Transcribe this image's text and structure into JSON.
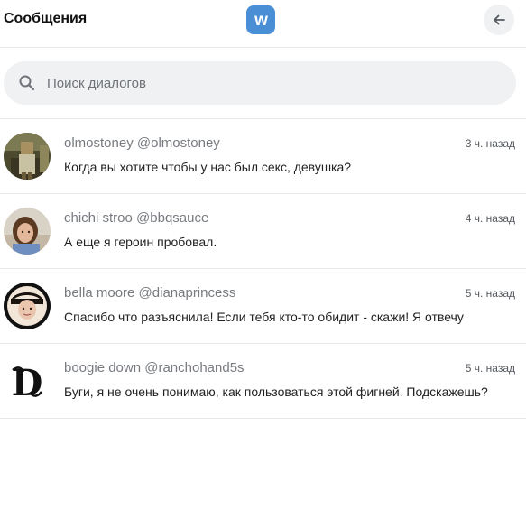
{
  "header": {
    "title": "Сообщения",
    "logo_letter": "w",
    "back_icon": "arrow-left-icon"
  },
  "search": {
    "placeholder": "Поиск диалогов",
    "value": "",
    "icon": "search-icon"
  },
  "colors": {
    "brand": "#4a8fd6",
    "surface": "#f0f1f3",
    "divider": "#e8e8ea"
  },
  "conversations": [
    {
      "display_name": "olmostoney @olmostoney",
      "time": "3 ч. назад",
      "last_message": "Когда вы хотите чтобы у нас был секс, девушка?"
    },
    {
      "display_name": "chichi stroo @bbqsauce",
      "time": "4 ч. назад",
      "last_message": "А еще я героин пробовал."
    },
    {
      "display_name": "bella moore @dianaprincess",
      "time": "5 ч. назад",
      "last_message": "Спасибо что разъяснила! Если тебя кто-то обидит - скажи! Я отвечу"
    },
    {
      "display_name": "boogie down @ranchohand5s",
      "time": "5 ч. назад",
      "last_message": "Буги, я не очень понимаю, как пользоваться этой фигней. Подскажешь?"
    }
  ]
}
